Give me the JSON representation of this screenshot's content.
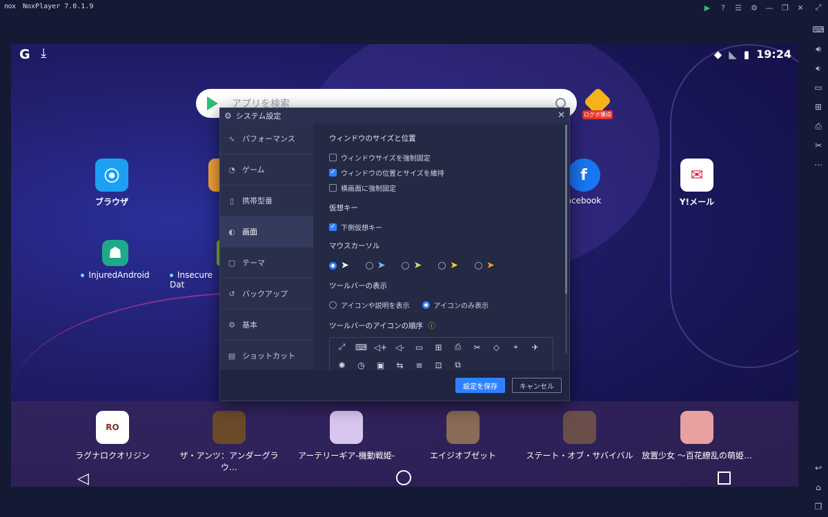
{
  "window": {
    "logo": "nox",
    "title": "NoxPlayer 7.0.1.9"
  },
  "titlebar_buttons": [
    "play-icon",
    "help-icon",
    "menu-icon",
    "settings-icon",
    "minimize-icon",
    "restore-icon",
    "close-icon"
  ],
  "right_toolbar": [
    "fullscreen-icon",
    "keyboard-icon",
    "volume-up-icon",
    "volume-down-icon",
    "screen-icon",
    "add-apk-icon",
    "printer-icon",
    "scissors-icon",
    "more-icon",
    "back-icon",
    "home-icon",
    "recent-icon"
  ],
  "status": {
    "time": "19:24"
  },
  "search": {
    "placeholder": "アプリを検索"
  },
  "gift": {
    "label": "ログボ獲得"
  },
  "home_apps": [
    {
      "label": "ブラウザ"
    },
    {
      "label": "acebook"
    },
    {
      "label": "Y!メール"
    },
    {
      "label": "InjuredAndroid"
    },
    {
      "label": "Insecure Dat"
    }
  ],
  "dock_apps": [
    {
      "label": "ラグナロクオリジン"
    },
    {
      "label": "ザ・アンツ：アンダーグラウ…"
    },
    {
      "label": "アーテリーギア-機動戦姫-"
    },
    {
      "label": "エイジオブゼット"
    },
    {
      "label": "ステート・オブ・サバイバル"
    },
    {
      "label": "放置少女 〜百花繚乱の萌姫…"
    }
  ],
  "dialog": {
    "title": "システム設定",
    "menu": [
      {
        "label": "パフォーマンス",
        "icon": "performance-icon"
      },
      {
        "label": "ゲーム",
        "icon": "game-icon"
      },
      {
        "label": "携帯型番",
        "icon": "phone-icon"
      },
      {
        "label": "画面",
        "icon": "display-icon",
        "active": true
      },
      {
        "label": "テーマ",
        "icon": "theme-icon"
      },
      {
        "label": "バックアップ",
        "icon": "backup-icon"
      },
      {
        "label": "基本",
        "icon": "basic-icon"
      },
      {
        "label": "ショットカット",
        "icon": "shortcut-icon"
      }
    ],
    "window_section": {
      "title": "ウィンドウのサイズと位置",
      "options": [
        {
          "label": "ウィンドウサイズを強制固定",
          "checked": false
        },
        {
          "label": "ウィンドウの位置とサイズを維持",
          "checked": true
        },
        {
          "label": "横画面に強制固定",
          "checked": false
        }
      ]
    },
    "virtual_key_section": {
      "title": "仮想キー",
      "options": [
        {
          "label": "下側仮想キー",
          "checked": true
        }
      ]
    },
    "cursor_section": {
      "title": "マウスカーソル",
      "selected_index": 0,
      "cursors": [
        "cursor-white-icon",
        "cursor-blue-icon",
        "cursor-green-icon",
        "cursor-yellow-icon",
        "cursor-orange-icon"
      ]
    },
    "toolbar_display_section": {
      "title": "ツールバーの表示",
      "options": [
        {
          "label": "アイコンや説明を表示",
          "selected": false
        },
        {
          "label": "アイコンのみ表示",
          "selected": true
        }
      ]
    },
    "toolbar_order_section": {
      "title": "ツールバーのアイコンの順序"
    },
    "save_label": "設定を保存",
    "cancel_label": "キャンセル"
  }
}
